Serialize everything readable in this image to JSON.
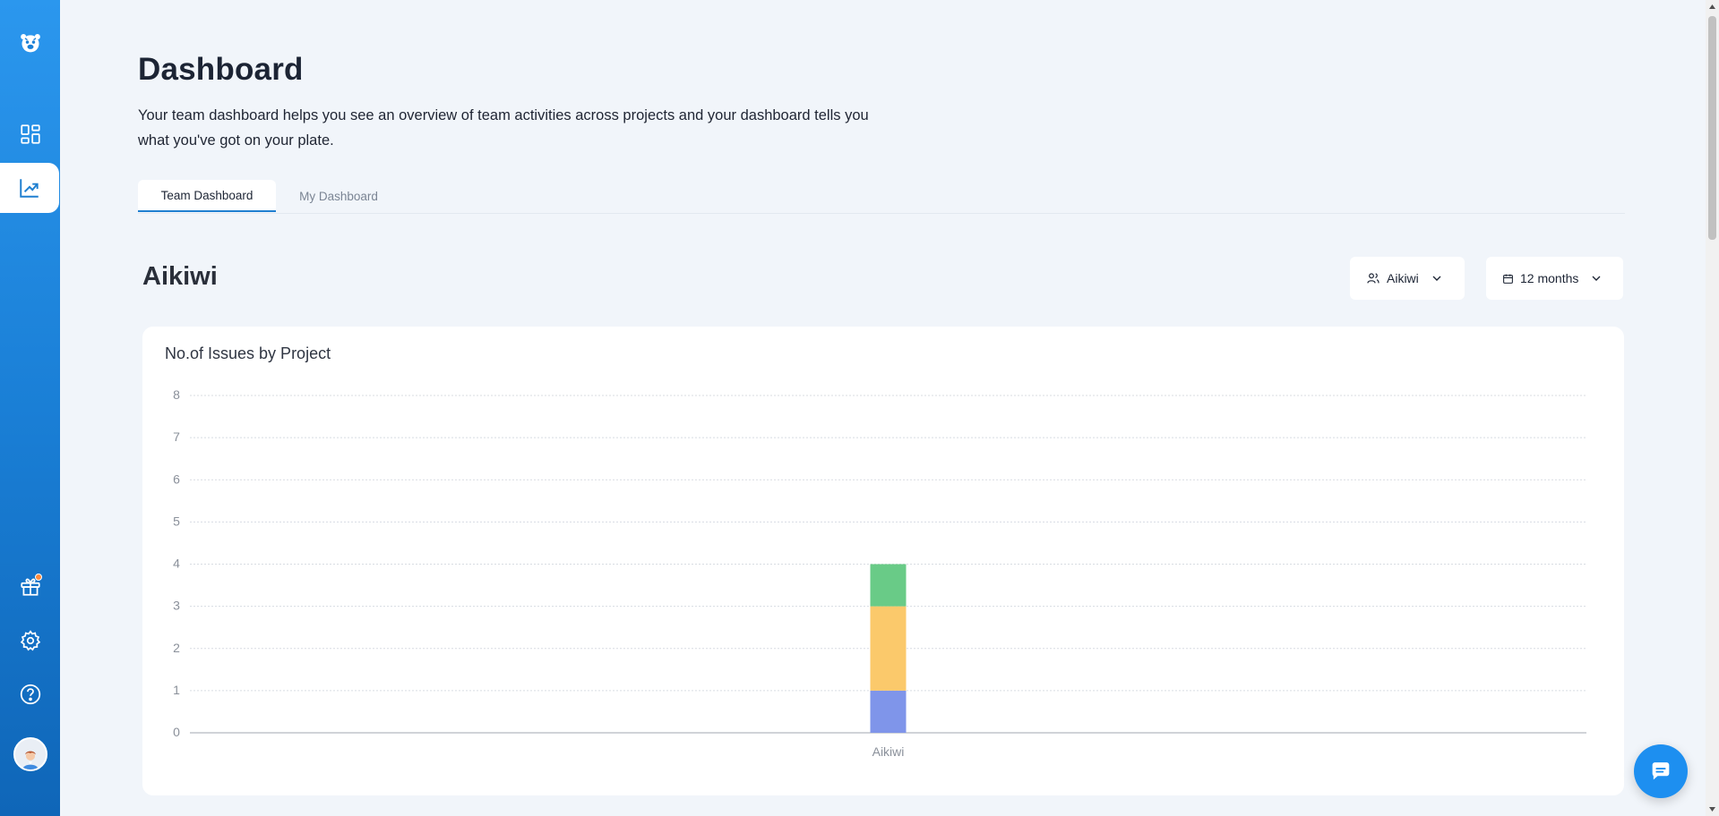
{
  "page": {
    "title": "Dashboard",
    "description": "Your team dashboard helps you see an overview of team activities across projects and your dashboard tells you what you've got on your plate."
  },
  "tabs": [
    {
      "label": "Team Dashboard",
      "active": true
    },
    {
      "label": "My Dashboard",
      "active": false
    }
  ],
  "section": {
    "title": "Aikiwi"
  },
  "filters": {
    "team": "Aikiwi",
    "range": "12 months"
  },
  "sidebar": {
    "items": [
      {
        "icon": "tiger-logo-icon"
      },
      {
        "icon": "dashboard-grid-icon"
      },
      {
        "icon": "chart-trend-icon",
        "active": true
      },
      {
        "icon": "gift-icon",
        "badge": true
      },
      {
        "icon": "gear-icon"
      },
      {
        "icon": "help-circle-icon"
      },
      {
        "icon": "user-avatar"
      }
    ]
  },
  "colors": {
    "sidebar_top": "#2b97ee",
    "sidebar_bottom": "#0f66b8",
    "accent": "#1f7fd0",
    "series_a": "#7f95ea",
    "series_b": "#fbc96b",
    "series_c": "#69cb87"
  },
  "chart_data": {
    "type": "bar",
    "title": "No.of Issues by Project",
    "categories": [
      "Aikiwi"
    ],
    "stacked": true,
    "series": [
      {
        "values": [
          1
        ],
        "color": "#7f95ea"
      },
      {
        "values": [
          2
        ],
        "color": "#fbc96b"
      },
      {
        "values": [
          1
        ],
        "color": "#69cb87"
      }
    ],
    "yticks": [
      0,
      1,
      2,
      3,
      4,
      5,
      6,
      7,
      8
    ],
    "ylim": [
      0,
      8
    ],
    "grid": true,
    "legend": "none"
  }
}
